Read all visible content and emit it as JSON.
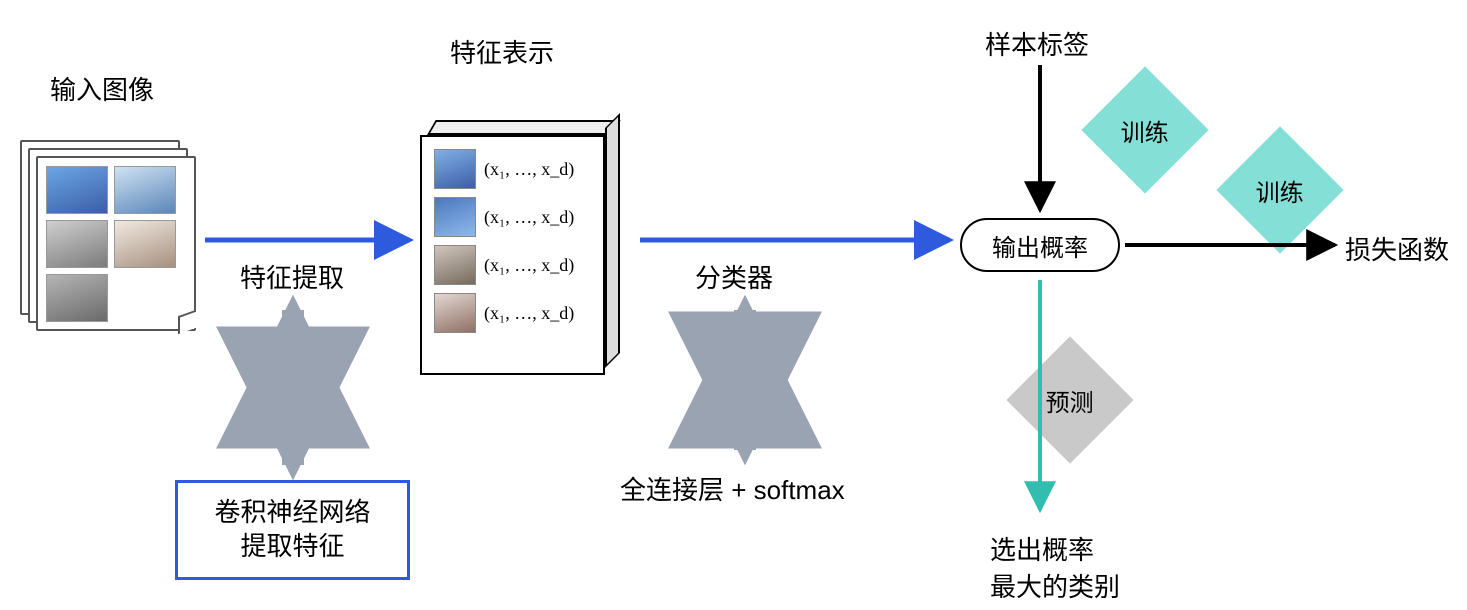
{
  "labels": {
    "input_images": "输入图像",
    "feature_representation": "特征表示",
    "feature_extraction": "特征提取",
    "cnn_extract": "卷积神经网络\n提取特征",
    "classifier": "分类器",
    "fc_softmax": "全连接层 + softmax",
    "sample_labels": "样本标签",
    "output_prob": "输出概率",
    "loss_fn": "损失函数",
    "train": "训练",
    "predict": "预测",
    "select_max_class": "选出概率\n最大的类别"
  },
  "feature_vectors": [
    "(x₁, …, x_d)",
    "(x₁, …, x_d)",
    "(x₁, …, x_d)",
    "(x₁, …, x_d)"
  ],
  "colors": {
    "blue_arrow": "#2e5bde",
    "teal": "#31bdb0",
    "grey": "#b0b0b0",
    "black": "#000000"
  }
}
